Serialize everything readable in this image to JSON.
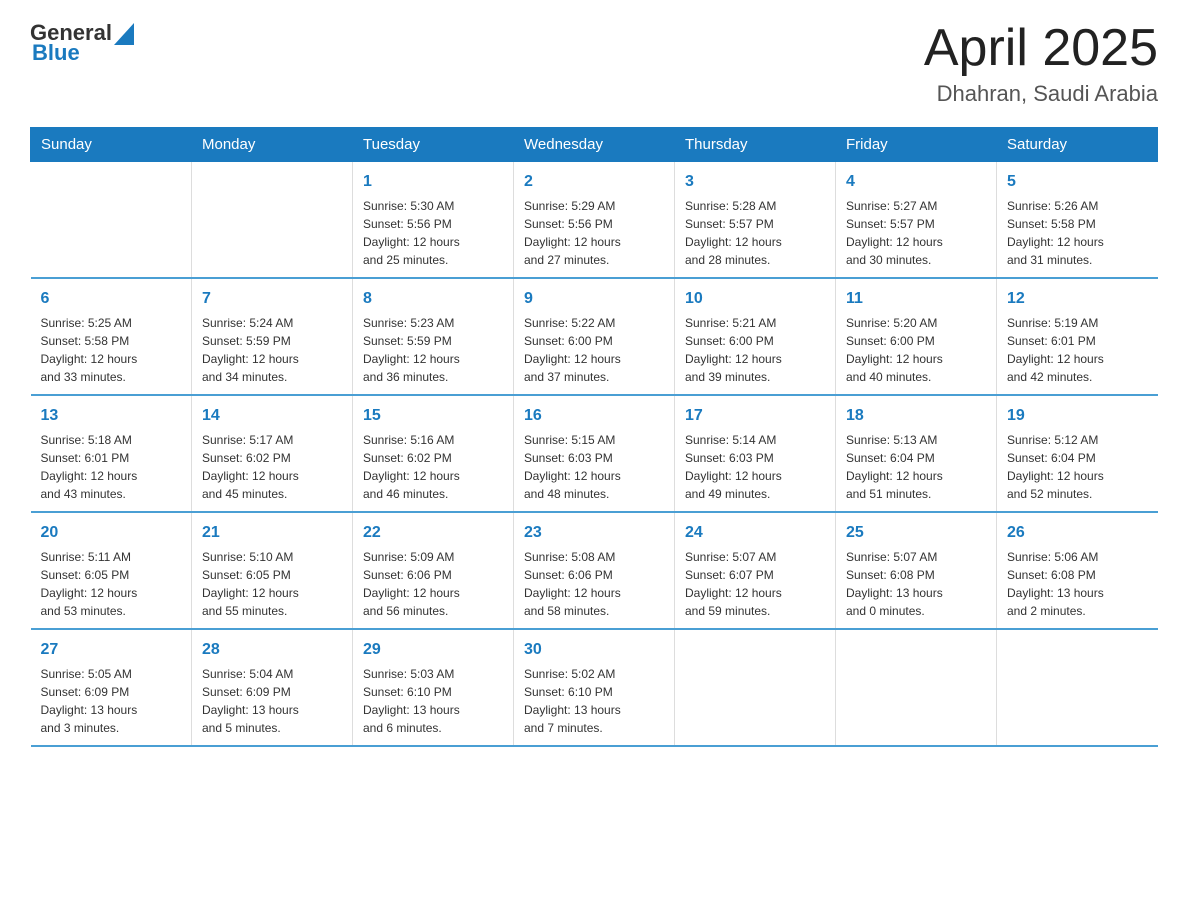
{
  "header": {
    "logo_general": "General",
    "logo_blue": "Blue",
    "month": "April 2025",
    "location": "Dhahran, Saudi Arabia"
  },
  "weekdays": [
    "Sunday",
    "Monday",
    "Tuesday",
    "Wednesday",
    "Thursday",
    "Friday",
    "Saturday"
  ],
  "weeks": [
    [
      {
        "day": "",
        "info": ""
      },
      {
        "day": "",
        "info": ""
      },
      {
        "day": "1",
        "info": "Sunrise: 5:30 AM\nSunset: 5:56 PM\nDaylight: 12 hours\nand 25 minutes."
      },
      {
        "day": "2",
        "info": "Sunrise: 5:29 AM\nSunset: 5:56 PM\nDaylight: 12 hours\nand 27 minutes."
      },
      {
        "day": "3",
        "info": "Sunrise: 5:28 AM\nSunset: 5:57 PM\nDaylight: 12 hours\nand 28 minutes."
      },
      {
        "day": "4",
        "info": "Sunrise: 5:27 AM\nSunset: 5:57 PM\nDaylight: 12 hours\nand 30 minutes."
      },
      {
        "day": "5",
        "info": "Sunrise: 5:26 AM\nSunset: 5:58 PM\nDaylight: 12 hours\nand 31 minutes."
      }
    ],
    [
      {
        "day": "6",
        "info": "Sunrise: 5:25 AM\nSunset: 5:58 PM\nDaylight: 12 hours\nand 33 minutes."
      },
      {
        "day": "7",
        "info": "Sunrise: 5:24 AM\nSunset: 5:59 PM\nDaylight: 12 hours\nand 34 minutes."
      },
      {
        "day": "8",
        "info": "Sunrise: 5:23 AM\nSunset: 5:59 PM\nDaylight: 12 hours\nand 36 minutes."
      },
      {
        "day": "9",
        "info": "Sunrise: 5:22 AM\nSunset: 6:00 PM\nDaylight: 12 hours\nand 37 minutes."
      },
      {
        "day": "10",
        "info": "Sunrise: 5:21 AM\nSunset: 6:00 PM\nDaylight: 12 hours\nand 39 minutes."
      },
      {
        "day": "11",
        "info": "Sunrise: 5:20 AM\nSunset: 6:00 PM\nDaylight: 12 hours\nand 40 minutes."
      },
      {
        "day": "12",
        "info": "Sunrise: 5:19 AM\nSunset: 6:01 PM\nDaylight: 12 hours\nand 42 minutes."
      }
    ],
    [
      {
        "day": "13",
        "info": "Sunrise: 5:18 AM\nSunset: 6:01 PM\nDaylight: 12 hours\nand 43 minutes."
      },
      {
        "day": "14",
        "info": "Sunrise: 5:17 AM\nSunset: 6:02 PM\nDaylight: 12 hours\nand 45 minutes."
      },
      {
        "day": "15",
        "info": "Sunrise: 5:16 AM\nSunset: 6:02 PM\nDaylight: 12 hours\nand 46 minutes."
      },
      {
        "day": "16",
        "info": "Sunrise: 5:15 AM\nSunset: 6:03 PM\nDaylight: 12 hours\nand 48 minutes."
      },
      {
        "day": "17",
        "info": "Sunrise: 5:14 AM\nSunset: 6:03 PM\nDaylight: 12 hours\nand 49 minutes."
      },
      {
        "day": "18",
        "info": "Sunrise: 5:13 AM\nSunset: 6:04 PM\nDaylight: 12 hours\nand 51 minutes."
      },
      {
        "day": "19",
        "info": "Sunrise: 5:12 AM\nSunset: 6:04 PM\nDaylight: 12 hours\nand 52 minutes."
      }
    ],
    [
      {
        "day": "20",
        "info": "Sunrise: 5:11 AM\nSunset: 6:05 PM\nDaylight: 12 hours\nand 53 minutes."
      },
      {
        "day": "21",
        "info": "Sunrise: 5:10 AM\nSunset: 6:05 PM\nDaylight: 12 hours\nand 55 minutes."
      },
      {
        "day": "22",
        "info": "Sunrise: 5:09 AM\nSunset: 6:06 PM\nDaylight: 12 hours\nand 56 minutes."
      },
      {
        "day": "23",
        "info": "Sunrise: 5:08 AM\nSunset: 6:06 PM\nDaylight: 12 hours\nand 58 minutes."
      },
      {
        "day": "24",
        "info": "Sunrise: 5:07 AM\nSunset: 6:07 PM\nDaylight: 12 hours\nand 59 minutes."
      },
      {
        "day": "25",
        "info": "Sunrise: 5:07 AM\nSunset: 6:08 PM\nDaylight: 13 hours\nand 0 minutes."
      },
      {
        "day": "26",
        "info": "Sunrise: 5:06 AM\nSunset: 6:08 PM\nDaylight: 13 hours\nand 2 minutes."
      }
    ],
    [
      {
        "day": "27",
        "info": "Sunrise: 5:05 AM\nSunset: 6:09 PM\nDaylight: 13 hours\nand 3 minutes."
      },
      {
        "day": "28",
        "info": "Sunrise: 5:04 AM\nSunset: 6:09 PM\nDaylight: 13 hours\nand 5 minutes."
      },
      {
        "day": "29",
        "info": "Sunrise: 5:03 AM\nSunset: 6:10 PM\nDaylight: 13 hours\nand 6 minutes."
      },
      {
        "day": "30",
        "info": "Sunrise: 5:02 AM\nSunset: 6:10 PM\nDaylight: 13 hours\nand 7 minutes."
      },
      {
        "day": "",
        "info": ""
      },
      {
        "day": "",
        "info": ""
      },
      {
        "day": "",
        "info": ""
      }
    ]
  ]
}
